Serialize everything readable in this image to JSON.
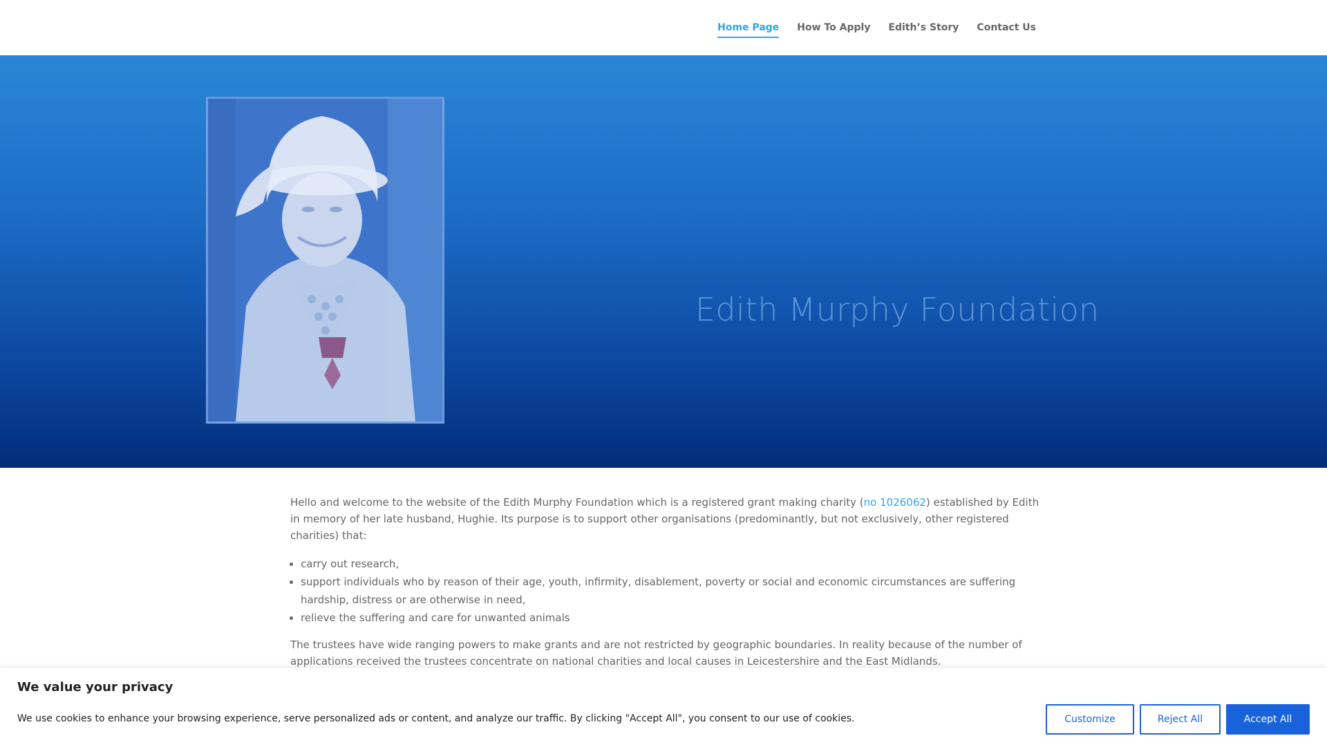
{
  "nav": {
    "items": [
      {
        "label": "Home Page",
        "active": true
      },
      {
        "label": "How To Apply",
        "active": false
      },
      {
        "label": "Edith’s Story",
        "active": false
      },
      {
        "label": "Contact Us",
        "active": false
      }
    ],
    "active_color": "#2ea3f2"
  },
  "hero": {
    "title": "Edith Murphy Foundation",
    "gradient_top": "#2a86d8",
    "gradient_bottom": "#032d7a"
  },
  "content": {
    "intro_before_link": "Hello and welcome to the website of the Edith Murphy Foundation which is a registered grant making charity (",
    "charity_link": "no 1026062",
    "intro_after_link": ") established by Edith in memory of her late husband, Hughie. Its purpose is to support other organisations (predominantly, but not exclusively, other registered charities) that:",
    "bullets": [
      "carry out research,",
      "support individuals who by reason of their age, youth, infirmity, disablement, poverty or social and economic circumstances are suffering hardship, distress or are otherwise in need,",
      "relieve the suffering and care for unwanted animals"
    ],
    "trustees_paragraph": "The trustees have wide ranging powers to make grants and are not restricted by geographic boundaries. In reality because of the number of applications received the trustees concentrate on national charities and local causes in Leicestershire and the East Midlands."
  },
  "cookie": {
    "title": "We value your privacy",
    "text": "We use cookies to enhance your browsing experience, serve personalized ads or content, and analyze our traffic. By clicking \"Accept All\", you consent to our use of cookies.",
    "customize_label": "Customize",
    "reject_label": "Reject All",
    "accept_label": "Accept All",
    "accent_color": "#1863dc"
  }
}
